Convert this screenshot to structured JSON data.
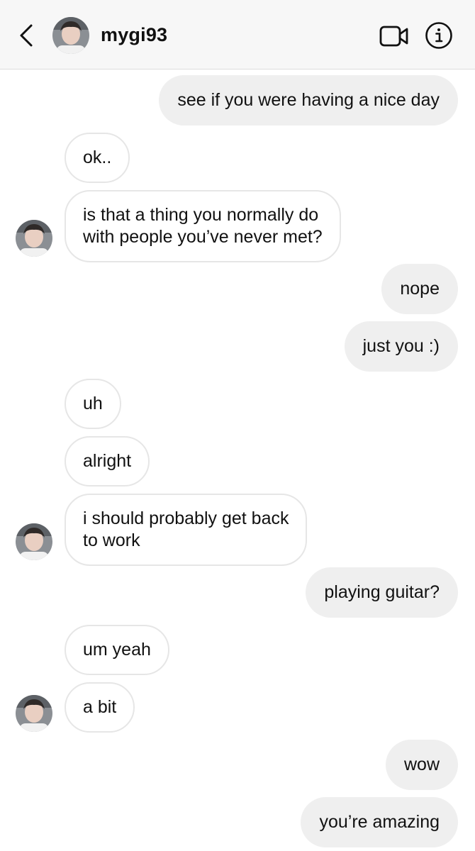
{
  "header": {
    "username": "mygi93"
  },
  "icons": {
    "back": "chevron-left-icon",
    "video": "video-camera-icon",
    "info": "info-circle-icon"
  },
  "colors": {
    "header_bg": "#f7f7f7",
    "sent_bubble": "#efefef",
    "received_bubble": "#ffffff",
    "received_border": "#e6e6e6"
  },
  "messages": [
    {
      "from": "me",
      "text": "see if you were having a nice day"
    },
    {
      "from": "them",
      "text": "ok.."
    },
    {
      "from": "them",
      "lines": [
        "is that a thing you normally do",
        "with people you’ve never met?"
      ]
    },
    {
      "from": "me",
      "text": "nope"
    },
    {
      "from": "me",
      "text": "just you :)"
    },
    {
      "from": "them",
      "text": "uh"
    },
    {
      "from": "them",
      "text": "alright"
    },
    {
      "from": "them",
      "lines": [
        "i should probably get back",
        "to work"
      ]
    },
    {
      "from": "me",
      "text": "playing guitar?"
    },
    {
      "from": "them",
      "text": "um yeah"
    },
    {
      "from": "them",
      "text": "a bit"
    },
    {
      "from": "me",
      "text": "wow"
    },
    {
      "from": "me",
      "text": "you’re amazing"
    }
  ]
}
